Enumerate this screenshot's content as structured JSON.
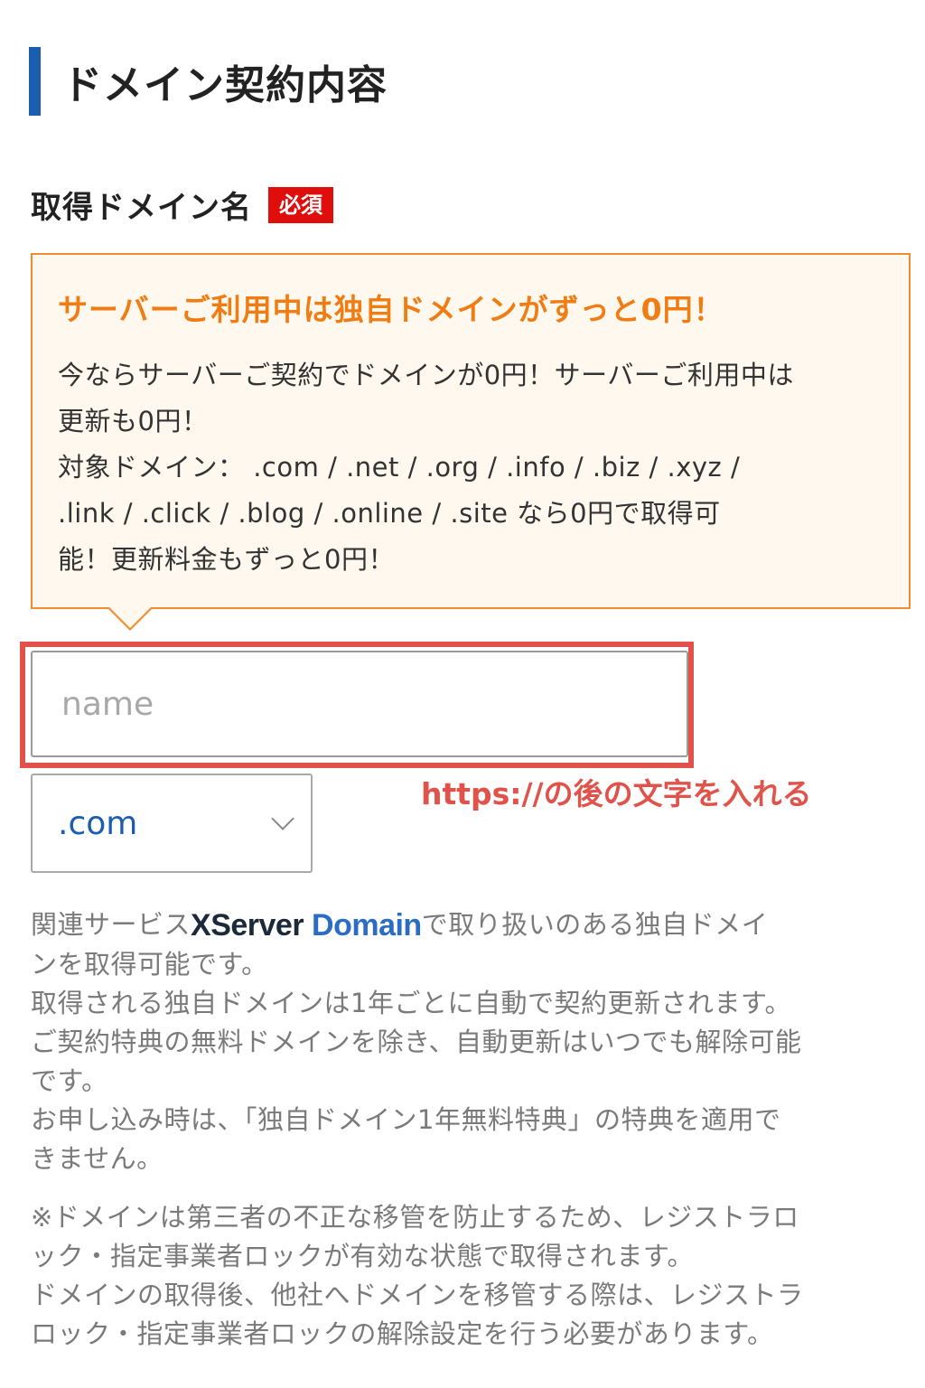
{
  "section": {
    "title": "ドメイン契約内容"
  },
  "field": {
    "label": "取得ドメイン名",
    "required_badge": "必須"
  },
  "promo": {
    "title": "サーバーご利用中は独自ドメインがずっと0円！",
    "lines": [
      "今ならサーバーご契約でドメインが0円！サーバーご利用中は",
      "更新も0円！",
      "対象ドメイン： .com / .net / .org / .info / .biz / .xyz /",
      ".link / .click / .blog / .online / .site なら0円で取得可",
      "能！更新料金もずっと0円！"
    ]
  },
  "domain_input": {
    "placeholder": "name",
    "value": ""
  },
  "annotation": {
    "text": "https://の後の文字を入れる"
  },
  "tld_select": {
    "selected": ".com"
  },
  "description": {
    "prefix": "関連サービス",
    "logo_x": "XServer",
    "logo_domain": "Domain",
    "suffix_line1": "で取り扱いのある独自ドメイ",
    "line2": "ンを取得可能です。",
    "line3": "取得される独自ドメインは1年ごとに自動で契約更新されます。",
    "line4": "ご契約特典の無料ドメインを除き、自動更新はいつでも解除可能",
    "line5": "です。",
    "line6": "お申し込み時は、「独自ドメイン1年無料特典」の特典を適用で",
    "line7": "きません。"
  },
  "notice": {
    "lines": [
      "※ドメインは第三者の不正な移管を防止するため、レジストラロ",
      "ック・指定事業者ロックが有効な状態で取得されます。",
      "ドメインの取得後、他社へドメインを移管する際は、レジストラ",
      "ロック・指定事業者ロックの解除設定を行う必要があります。"
    ]
  },
  "colors": {
    "accent_blue": "#1b5eb0",
    "required_red": "#e00d0d",
    "promo_orange": "#f07d14",
    "annotation_red": "#e0524a"
  },
  "icons": {
    "select_arrow": "chevron-down-icon"
  }
}
